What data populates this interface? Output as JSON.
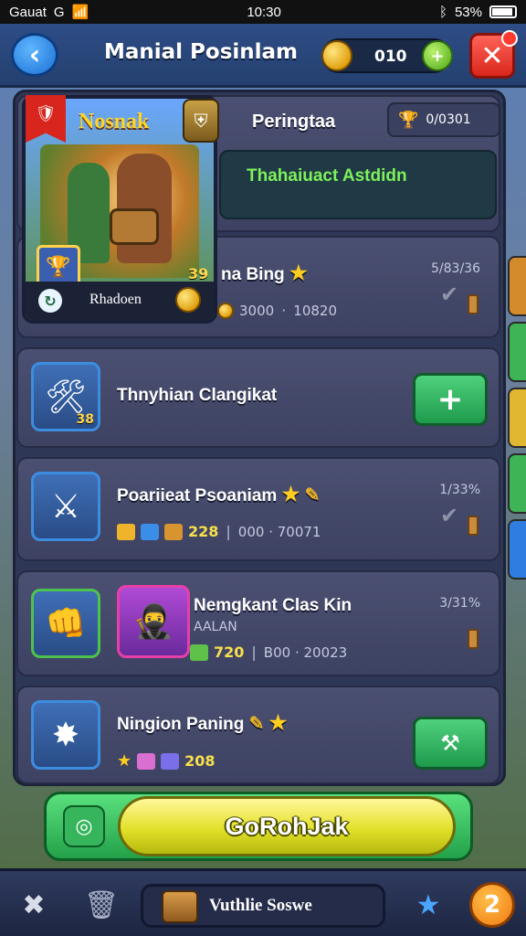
{
  "status_bar": {
    "carrier": "Gauat",
    "network": "G",
    "time": "10:30",
    "battery": "53%"
  },
  "header": {
    "title": "Manial Posinlam",
    "coin_count": "010",
    "plus_label": "+",
    "close_label": "✕"
  },
  "hero": {
    "name": "Nosnak",
    "level": "39",
    "footer_name": "Rhadoen"
  },
  "top_section": {
    "title": "Peringtaa",
    "badge": "0/0301",
    "subtitle": "Thahaiuact Astdidn"
  },
  "rows": [
    {
      "title": "na Bing",
      "coins": "3000",
      "range": "10820",
      "pct": "5/83/36"
    },
    {
      "title": "Thnyhian Clangikat",
      "level": "38",
      "button": "+"
    },
    {
      "title": "Poariieat Psoaniam",
      "coins": "228",
      "range": "000 · 70071",
      "pct": "1/33%"
    },
    {
      "title": "Nemgkant Clas Kin",
      "subtitle": "AALAN",
      "coins": "720",
      "range": "B00 · 20023",
      "pct": "3/31%"
    },
    {
      "title": "Ningion Paning",
      "coins": "208"
    }
  ],
  "action": {
    "go_label": "GoRohJak"
  },
  "navbar": {
    "shop_label": "Vuthlie Soswe",
    "badge_number": "2"
  },
  "colors": {
    "accent_green": "#23a14a",
    "accent_yellow": "#e2e12a",
    "panel": "#2f3757",
    "close_red": "#d9271c"
  }
}
